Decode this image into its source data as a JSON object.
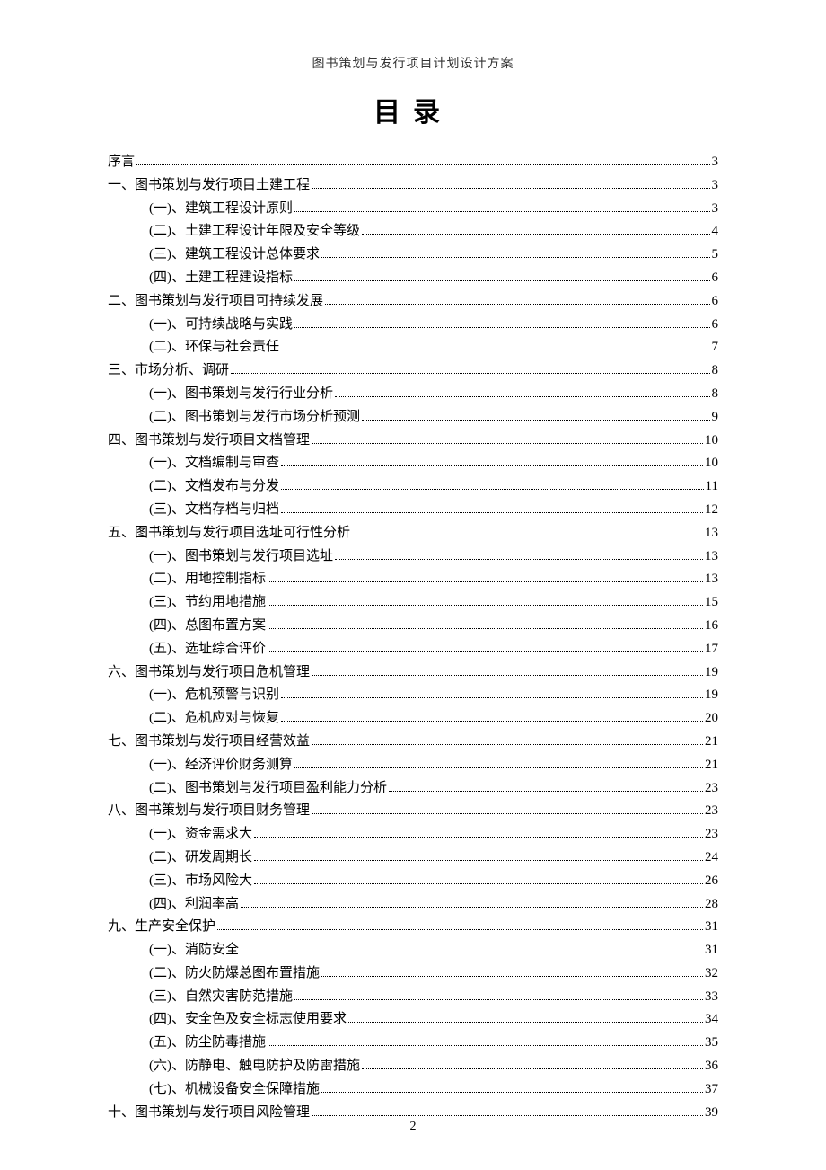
{
  "header": "图书策划与发行项目计划设计方案",
  "title": "目录",
  "page_number": "2",
  "toc": [
    {
      "level": 1,
      "label": "序言",
      "page": "3"
    },
    {
      "level": 1,
      "label": "一、图书策划与发行项目土建工程",
      "page": "3"
    },
    {
      "level": 2,
      "label": "(一)、建筑工程设计原则",
      "page": "3"
    },
    {
      "level": 2,
      "label": "(二)、土建工程设计年限及安全等级",
      "page": "4"
    },
    {
      "level": 2,
      "label": "(三)、建筑工程设计总体要求",
      "page": "5"
    },
    {
      "level": 2,
      "label": "(四)、土建工程建设指标",
      "page": "6"
    },
    {
      "level": 1,
      "label": "二、图书策划与发行项目可持续发展",
      "page": "6"
    },
    {
      "level": 2,
      "label": "(一)、可持续战略与实践",
      "page": "6"
    },
    {
      "level": 2,
      "label": "(二)、环保与社会责任",
      "page": "7"
    },
    {
      "level": 1,
      "label": "三、市场分析、调研",
      "page": "8"
    },
    {
      "level": 2,
      "label": "(一)、图书策划与发行行业分析",
      "page": "8"
    },
    {
      "level": 2,
      "label": "(二)、图书策划与发行市场分析预测",
      "page": "9"
    },
    {
      "level": 1,
      "label": "四、图书策划与发行项目文档管理",
      "page": "10"
    },
    {
      "level": 2,
      "label": "(一)、文档编制与审查",
      "page": "10"
    },
    {
      "level": 2,
      "label": "(二)、文档发布与分发",
      "page": "11"
    },
    {
      "level": 2,
      "label": "(三)、文档存档与归档",
      "page": "12"
    },
    {
      "level": 1,
      "label": "五、图书策划与发行项目选址可行性分析",
      "page": "13"
    },
    {
      "level": 2,
      "label": "(一)、图书策划与发行项目选址",
      "page": "13"
    },
    {
      "level": 2,
      "label": "(二)、用地控制指标",
      "page": "13"
    },
    {
      "level": 2,
      "label": "(三)、节约用地措施",
      "page": "15"
    },
    {
      "level": 2,
      "label": "(四)、总图布置方案",
      "page": "16"
    },
    {
      "level": 2,
      "label": "(五)、选址综合评价",
      "page": "17"
    },
    {
      "level": 1,
      "label": "六、图书策划与发行项目危机管理",
      "page": "19"
    },
    {
      "level": 2,
      "label": "(一)、危机预警与识别",
      "page": "19"
    },
    {
      "level": 2,
      "label": "(二)、危机应对与恢复",
      "page": "20"
    },
    {
      "level": 1,
      "label": "七、图书策划与发行项目经营效益",
      "page": "21"
    },
    {
      "level": 2,
      "label": "(一)、经济评价财务测算",
      "page": "21"
    },
    {
      "level": 2,
      "label": "(二)、图书策划与发行项目盈利能力分析",
      "page": "23"
    },
    {
      "level": 1,
      "label": "八、图书策划与发行项目财务管理",
      "page": "23"
    },
    {
      "level": 2,
      "label": "(一)、资金需求大",
      "page": "23"
    },
    {
      "level": 2,
      "label": "(二)、研发周期长",
      "page": "24"
    },
    {
      "level": 2,
      "label": "(三)、市场风险大",
      "page": "26"
    },
    {
      "level": 2,
      "label": "(四)、利润率高",
      "page": "28"
    },
    {
      "level": 1,
      "label": "九、生产安全保护",
      "page": "31"
    },
    {
      "level": 2,
      "label": "(一)、消防安全",
      "page": "31"
    },
    {
      "level": 2,
      "label": "(二)、防火防爆总图布置措施",
      "page": "32"
    },
    {
      "level": 2,
      "label": "(三)、自然灾害防范措施",
      "page": "33"
    },
    {
      "level": 2,
      "label": "(四)、安全色及安全标志使用要求",
      "page": "34"
    },
    {
      "level": 2,
      "label": "(五)、防尘防毒措施",
      "page": "35"
    },
    {
      "level": 2,
      "label": "(六)、防静电、触电防护及防雷措施",
      "page": "36"
    },
    {
      "level": 2,
      "label": "(七)、机械设备安全保障措施",
      "page": "37"
    },
    {
      "level": 1,
      "label": "十、图书策划与发行项目风险管理",
      "page": "39"
    }
  ]
}
